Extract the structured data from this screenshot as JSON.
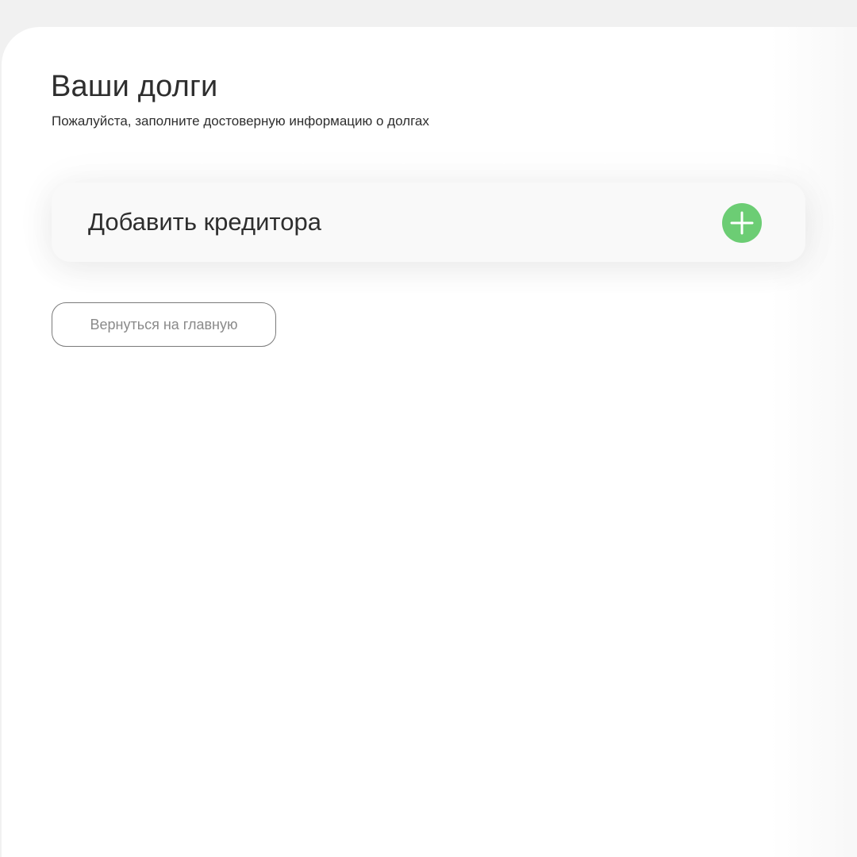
{
  "header": {
    "title": "Ваши долги",
    "subtitle": "Пожалуйста, заполните достоверную информацию о долгах"
  },
  "creditor_card": {
    "label": "Добавить кредитора",
    "add_icon": "plus-icon",
    "accent_color": "#6ccd74"
  },
  "actions": {
    "back_label": "Вернуться на главную"
  }
}
